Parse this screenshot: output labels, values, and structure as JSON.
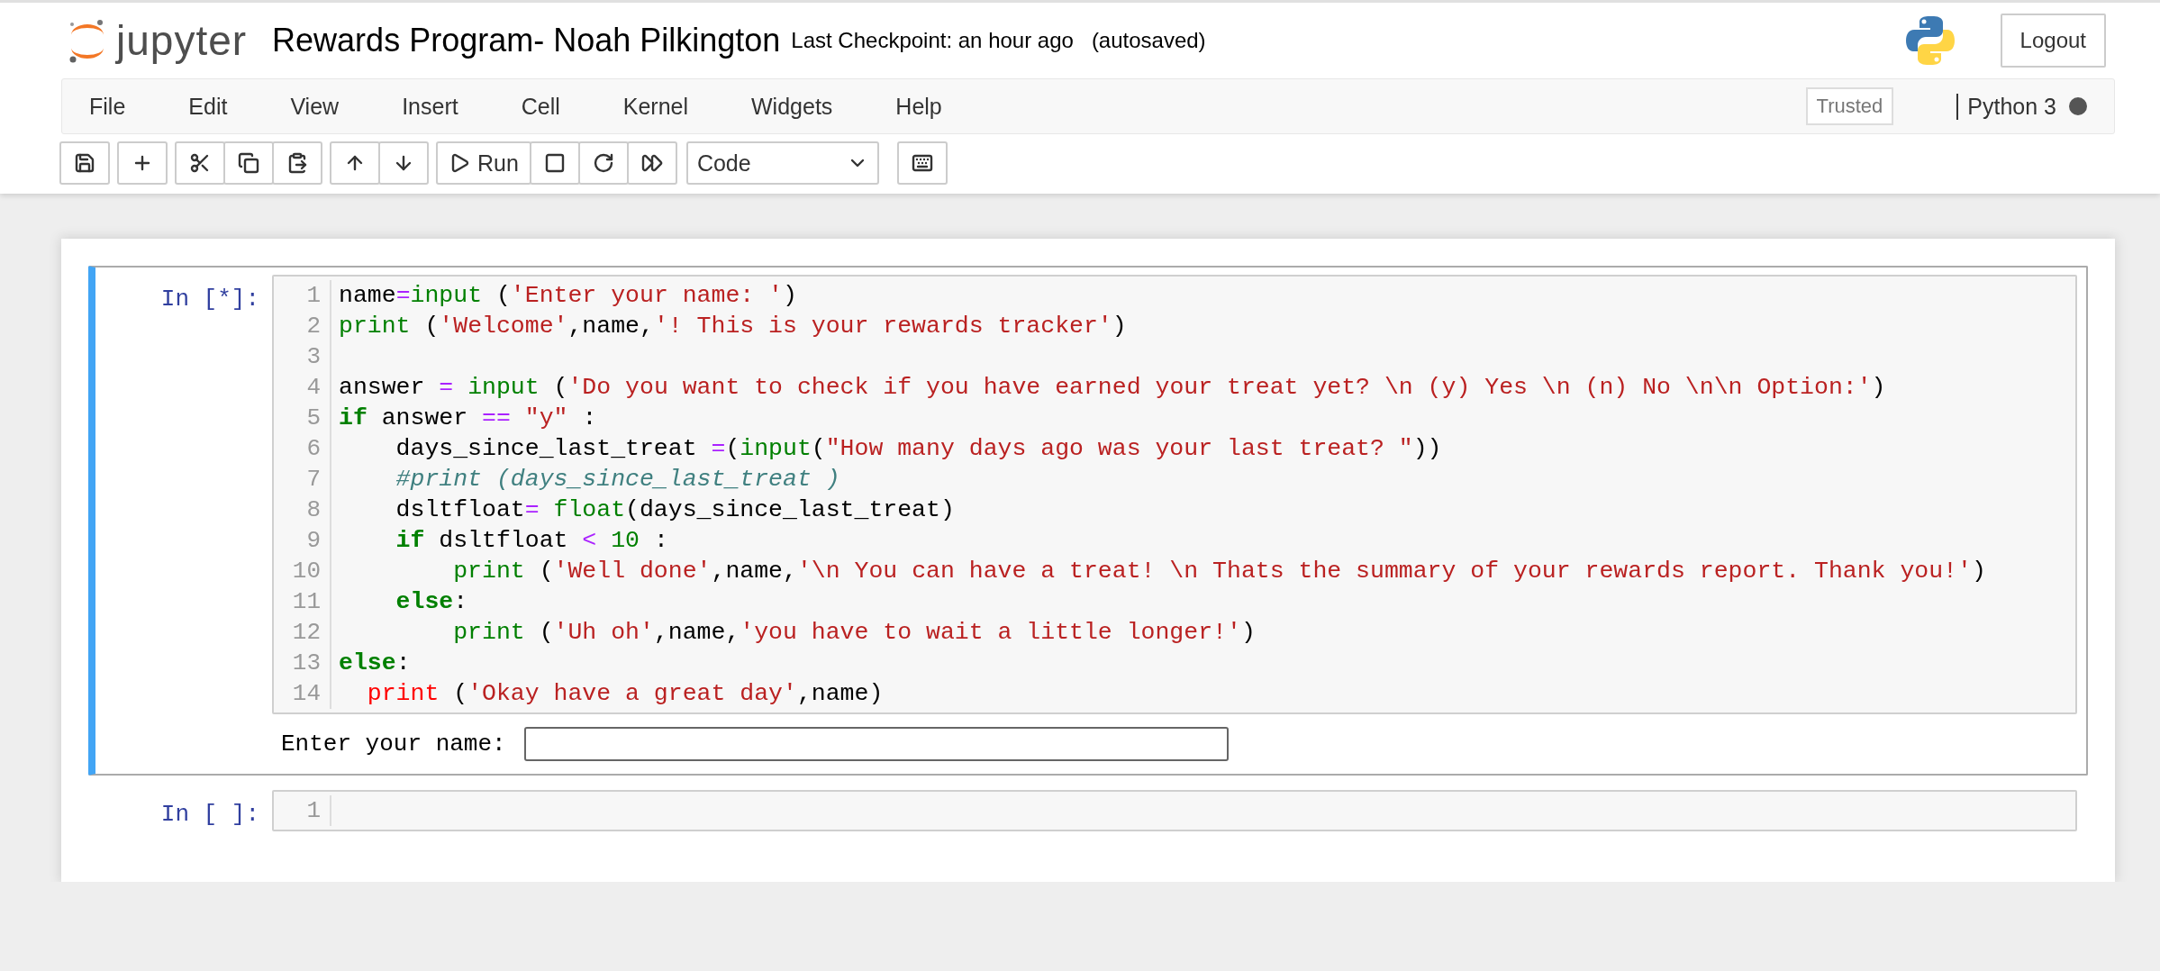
{
  "header": {
    "logo_text": "jupyter",
    "notebook_title": "Rewards Program- Noah Pilkington",
    "checkpoint": "Last Checkpoint: an hour ago",
    "autosave": "(autosaved)",
    "logout": "Logout"
  },
  "menu": [
    "File",
    "Edit",
    "View",
    "Insert",
    "Cell",
    "Kernel",
    "Widgets",
    "Help"
  ],
  "trusted": "Trusted",
  "kernel": {
    "name": "Python 3",
    "busy": true
  },
  "toolbar": {
    "run_label": "Run",
    "cell_type": "Code"
  },
  "cells": [
    {
      "prompt": "In [*]:",
      "selected": true,
      "lines": [
        {
          "number": "1",
          "tokens": [
            {
              "t": "name",
              "kind": "plain"
            },
            {
              "t": "=",
              "kind": "op"
            },
            {
              "t": "input",
              "kind": "builtin"
            },
            {
              "t": " (",
              "kind": "plain"
            },
            {
              "t": "'Enter your name: '",
              "kind": "str"
            },
            {
              "t": ")",
              "kind": "plain"
            }
          ]
        },
        {
          "number": "2",
          "tokens": [
            {
              "t": "print",
              "kind": "builtin"
            },
            {
              "t": " (",
              "kind": "plain"
            },
            {
              "t": "'Welcome'",
              "kind": "str"
            },
            {
              "t": ",name,",
              "kind": "plain"
            },
            {
              "t": "'! This is your rewards tracker'",
              "kind": "str"
            },
            {
              "t": ")",
              "kind": "plain"
            }
          ]
        },
        {
          "number": "3"
        },
        {
          "number": "4",
          "tokens": [
            {
              "t": "answer ",
              "kind": "plain"
            },
            {
              "t": "=",
              "kind": "op"
            },
            {
              "t": " input",
              "kind": "builtin"
            },
            {
              "t": " (",
              "kind": "plain"
            },
            {
              "t": "'Do you want to check if you have earned your treat yet? \\n (y) Yes \\n (n) No \\n\\n Option:'",
              "kind": "str"
            },
            {
              "t": ")",
              "kind": "plain"
            }
          ]
        },
        {
          "number": "5",
          "tokens": [
            {
              "t": "if",
              "kind": "kw"
            },
            {
              "t": " answer ",
              "kind": "plain"
            },
            {
              "t": "==",
              "kind": "op"
            },
            {
              "t": " \"y\"",
              "kind": "str"
            },
            {
              "t": " :",
              "kind": "plain"
            }
          ]
        },
        {
          "number": "6",
          "tokens": [
            {
              "t": "    days_since_last_treat ",
              "kind": "plain"
            },
            {
              "t": "=",
              "kind": "op"
            },
            {
              "t": "(",
              "kind": "plain"
            },
            {
              "t": "input",
              "kind": "builtin"
            },
            {
              "t": "(",
              "kind": "plain"
            },
            {
              "t": "\"How many days ago was your last treat? \"",
              "kind": "str"
            },
            {
              "t": "))",
              "kind": "plain"
            }
          ]
        },
        {
          "number": "7",
          "tokens": [
            {
              "t": "    #print (days_since_last_treat )",
              "kind": "comment"
            }
          ]
        },
        {
          "number": "8",
          "tokens": [
            {
              "t": "    dsltfloat",
              "kind": "plain"
            },
            {
              "t": "=",
              "kind": "op"
            },
            {
              "t": " float",
              "kind": "builtin"
            },
            {
              "t": "(days_since_last_treat)",
              "kind": "plain"
            }
          ]
        },
        {
          "number": "9",
          "tokens": [
            {
              "t": "    if",
              "kind": "kw"
            },
            {
              "t": " dsltfloat ",
              "kind": "plain"
            },
            {
              "t": "<",
              "kind": "op"
            },
            {
              "t": " 10",
              "kind": "num"
            },
            {
              "t": " :",
              "kind": "plain"
            }
          ]
        },
        {
          "number": "10",
          "tokens": [
            {
              "t": "        print",
              "kind": "builtin"
            },
            {
              "t": " (",
              "kind": "plain"
            },
            {
              "t": "'Well done'",
              "kind": "str"
            },
            {
              "t": ",name,",
              "kind": "plain"
            },
            {
              "t": "'\\n You can have a treat! \\n Thats the summary of your rewards report. Thank you!'",
              "kind": "str"
            },
            {
              "t": ")",
              "kind": "plain"
            }
          ]
        },
        {
          "number": "11",
          "tokens": [
            {
              "t": "    else",
              "kind": "kw"
            },
            {
              "t": ":",
              "kind": "plain"
            }
          ]
        },
        {
          "number": "12",
          "tokens": [
            {
              "t": "        print",
              "kind": "builtin"
            },
            {
              "t": " (",
              "kind": "plain"
            },
            {
              "t": "'Uh oh'",
              "kind": "str"
            },
            {
              "t": ",name,",
              "kind": "plain"
            },
            {
              "t": "'you have to wait a little longer!'",
              "kind": "str"
            },
            {
              "t": ")",
              "kind": "plain"
            }
          ]
        },
        {
          "number": "13",
          "tokens": [
            {
              "t": "else",
              "kind": "kw"
            },
            {
              "t": ":",
              "kind": "plain"
            }
          ]
        },
        {
          "number": "14",
          "tokens": [
            {
              "t": "  print",
              "kind": "error"
            },
            {
              "t": " (",
              "kind": "plain"
            },
            {
              "t": "'Okay have a great day'",
              "kind": "str"
            },
            {
              "t": ",name)",
              "kind": "plain"
            }
          ]
        }
      ],
      "stdin": {
        "prompt": "Enter your name:"
      }
    },
    {
      "prompt": "In [ ]:",
      "selected": false,
      "lines": [
        {
          "number": "1"
        }
      ]
    }
  ]
}
